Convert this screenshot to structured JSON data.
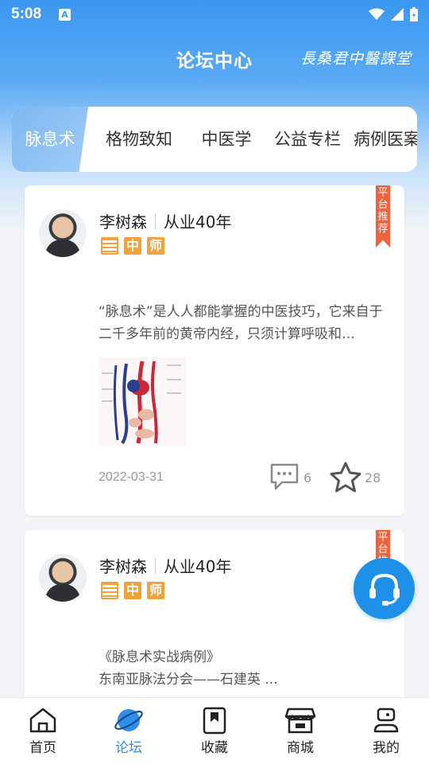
{
  "status_bar": {
    "time": "5:08",
    "notif_icon": "A"
  },
  "header": {
    "title": "论坛中心",
    "brand": "長桑君中醫課堂"
  },
  "tabs": [
    {
      "label": "脉息术",
      "active": true
    },
    {
      "label": "格物致知",
      "active": false
    },
    {
      "label": "中医学",
      "active": false
    },
    {
      "label": "公益专栏",
      "active": false
    },
    {
      "label": "病例医案",
      "active": false
    }
  ],
  "posts": [
    {
      "author": "李树森",
      "experience": "从业40年",
      "badges": [
        "",
        "中",
        "师"
      ],
      "ribbon": "平台推荐",
      "excerpt": "“脉息术”是人人都能掌握的中医技巧，它来自于二千多年前的黄帝内经，只须计算呼吸和…",
      "date": "2022-03-31",
      "comments": "6",
      "favorites": "28"
    },
    {
      "author": "李树森",
      "experience": "从业40年",
      "badges": [
        "",
        "中",
        "师"
      ],
      "ribbon": "平台推",
      "excerpt_line1": "《脉息术实战病例》",
      "excerpt_line2": "东南亚脉法分会——石建英 ..."
    }
  ],
  "bottom_nav": [
    {
      "label": "首页",
      "icon": "home-icon",
      "active": false
    },
    {
      "label": "论坛",
      "icon": "planet-icon",
      "active": true
    },
    {
      "label": "收藏",
      "icon": "bookmark-icon",
      "active": false
    },
    {
      "label": "商城",
      "icon": "store-icon",
      "active": false
    },
    {
      "label": "我的",
      "icon": "profile-icon",
      "active": false
    }
  ],
  "colors": {
    "primary": "#3b98f0",
    "accent_orange": "#f2a23a",
    "ribbon_red": "#f0623c",
    "active_nav": "#2f8ee8"
  }
}
